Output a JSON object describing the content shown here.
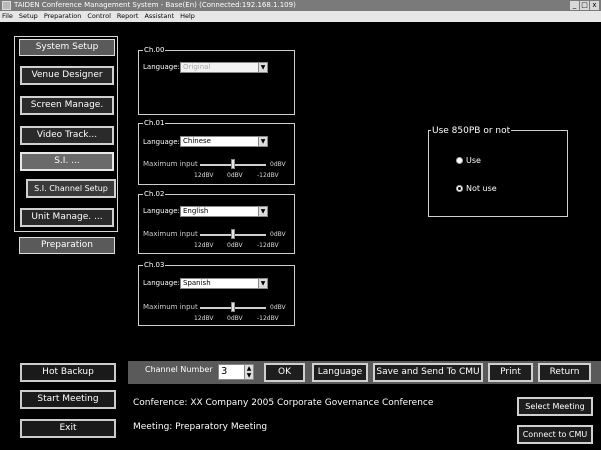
{
  "window": {
    "title": "TAIDEN Conference Management System - Base(En) (Connected:192.168.1.109)",
    "controls": [
      "_",
      "□",
      "x"
    ]
  },
  "menu": [
    "File",
    "Setup",
    "Preparation",
    "Control",
    "Report",
    "Assistant",
    "Help"
  ],
  "sidebar": {
    "system_setup": "System Setup",
    "items": [
      "Venue Designer",
      "Screen Manage.",
      "Video Track...",
      "S.I. ...",
      "S.I. Channel Setup",
      "Unit Manage. ..."
    ],
    "preparation": "Preparation",
    "hot_backup": "Hot Backup",
    "start_meeting": "Start Meeting",
    "exit": "Exit"
  },
  "channels": [
    {
      "legend": "Ch.00",
      "language_label": "Language:",
      "language": "Original",
      "disabled": true
    },
    {
      "legend": "Ch.01",
      "language_label": "Language:",
      "language": "Chinese",
      "max_label": "Maximum input",
      "ticks": [
        "12dBV",
        "0dBV",
        "-12dBV"
      ],
      "right_tick": "0dBV",
      "slider_value": 0.5
    },
    {
      "legend": "Ch.02",
      "language_label": "Language:",
      "language": "English",
      "max_label": "Maximum input",
      "ticks": [
        "12dBV",
        "0dBV",
        "-12dBV"
      ],
      "right_tick": "0dBV",
      "slider_value": 0.5
    },
    {
      "legend": "Ch.03",
      "language_label": "Language:",
      "language": "Spanish",
      "max_label": "Maximum input",
      "ticks": [
        "12dBV",
        "0dBV",
        "-12dBV"
      ],
      "right_tick": "0dBV",
      "slider_value": 0.5
    }
  ],
  "pb_group": {
    "legend": "Use 850PB or not",
    "use_label": "Use",
    "not_use_label": "Not use",
    "selected": "not_use"
  },
  "toolbar": {
    "channel_number_label": "Channel Number",
    "channel_number": "3",
    "ok": "OK",
    "language": "Language",
    "save_send": "Save and Send To CMU",
    "print": "Print",
    "return": "Return"
  },
  "info": {
    "conference": "Conference: XX Company 2005 Corporate Governance Conference",
    "meeting": "Meeting: Preparatory Meeting",
    "select_meeting": "Select Meeting",
    "connect_cmu": "Connect to CMU"
  }
}
